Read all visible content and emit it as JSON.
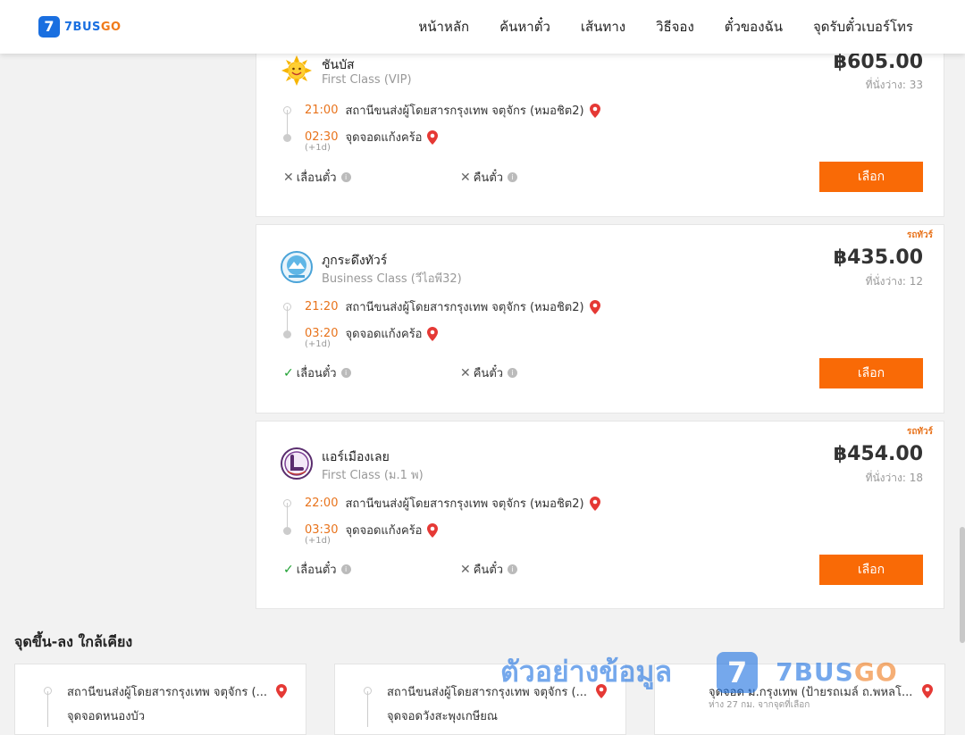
{
  "brand": {
    "mark": "7",
    "name_prefix": "7BUS",
    "name_suffix": "GO"
  },
  "nav": {
    "items": [
      "หน้าหลัก",
      "ค้นหาตั๋ว",
      "เส้นทาง",
      "วิธีจอง",
      "ตั๋วของฉัน",
      "จุดรับตั๋วเบอร์โทร"
    ]
  },
  "colors": {
    "accent": "#f96a06",
    "brand_blue": "#1a6fe0",
    "time": "#e8731c",
    "check": "#1ea032"
  },
  "trips": [
    {
      "tag": "",
      "operator": "ชันบัส",
      "bus_class": "First Class (VIP)",
      "logo_icon": "sun-logo",
      "price": "฿605.00",
      "seats": "ที่นั่งว่าง: 33",
      "depart_time": "21:00",
      "depart_place": "สถานีขนส่งผู้โดยสารกรุงเทพ จตุจักร (หมอชิต2)",
      "arrive_time": "02:30",
      "arrive_place": "จุดจอดแก้งคร้อ",
      "day_offset": "(+1d)",
      "reschedule": "เลื่อนตั๋ว",
      "reschedule_allowed": false,
      "refund": "คืนตั๋ว",
      "refund_allowed": false,
      "select_label": "เลือก"
    },
    {
      "tag": "รถทัวร์",
      "operator": "ภูกระดึงทัวร์",
      "bus_class": "Business Class (วีไอพี32)",
      "logo_icon": "phukradueng-logo",
      "price": "฿435.00",
      "seats": "ที่นั่งว่าง: 12",
      "depart_time": "21:20",
      "depart_place": "สถานีขนส่งผู้โดยสารกรุงเทพ จตุจักร (หมอชิต2)",
      "arrive_time": "03:20",
      "arrive_place": "จุดจอดแก้งคร้อ",
      "day_offset": "(+1d)",
      "reschedule": "เลื่อนตั๋ว",
      "reschedule_allowed": true,
      "refund": "คืนตั๋ว",
      "refund_allowed": false,
      "select_label": "เลือก"
    },
    {
      "tag": "รถทัวร์",
      "operator": "แอร์เมืองเลย",
      "bus_class": "First Class (ม.1 พ)",
      "logo_icon": "airmuangloei-logo",
      "price": "฿454.00",
      "seats": "ที่นั่งว่าง: 18",
      "depart_time": "22:00",
      "depart_place": "สถานีขนส่งผู้โดยสารกรุงเทพ จตุจักร (หมอชิต2)",
      "arrive_time": "03:30",
      "arrive_place": "จุดจอดแก้งคร้อ",
      "day_offset": "(+1d)",
      "reschedule": "เลื่อนตั๋ว",
      "reschedule_allowed": true,
      "refund": "คืนตั๋ว",
      "refund_allowed": false,
      "select_label": "เลือก"
    }
  ],
  "nearby": {
    "title": "จุดขึ้น-ลง ใกล้เคียง",
    "cards": [
      {
        "from": "สถานีขนส่งผู้โดยสารกรุงเทพ จตุจักร (...",
        "to": "จุดจอดหนองบัว",
        "sub": ""
      },
      {
        "from": "สถานีขนส่งผู้โดยสารกรุงเทพ จตุจักร (...",
        "to": "จุดจอดวังสะพุงเกษียณ",
        "sub": ""
      },
      {
        "from": "จุดจอด ม.กรุงเทพ (ป้ายรถเมล์ ถ.พหลโ...",
        "to": "",
        "sub": "ห่าง 27 กม. จากจุดที่เลือก"
      }
    ]
  },
  "watermark": {
    "text": "ตัวอย่างข้อมูล",
    "mark": "7",
    "brand_prefix": "7BUS",
    "brand_suffix": "GO"
  }
}
